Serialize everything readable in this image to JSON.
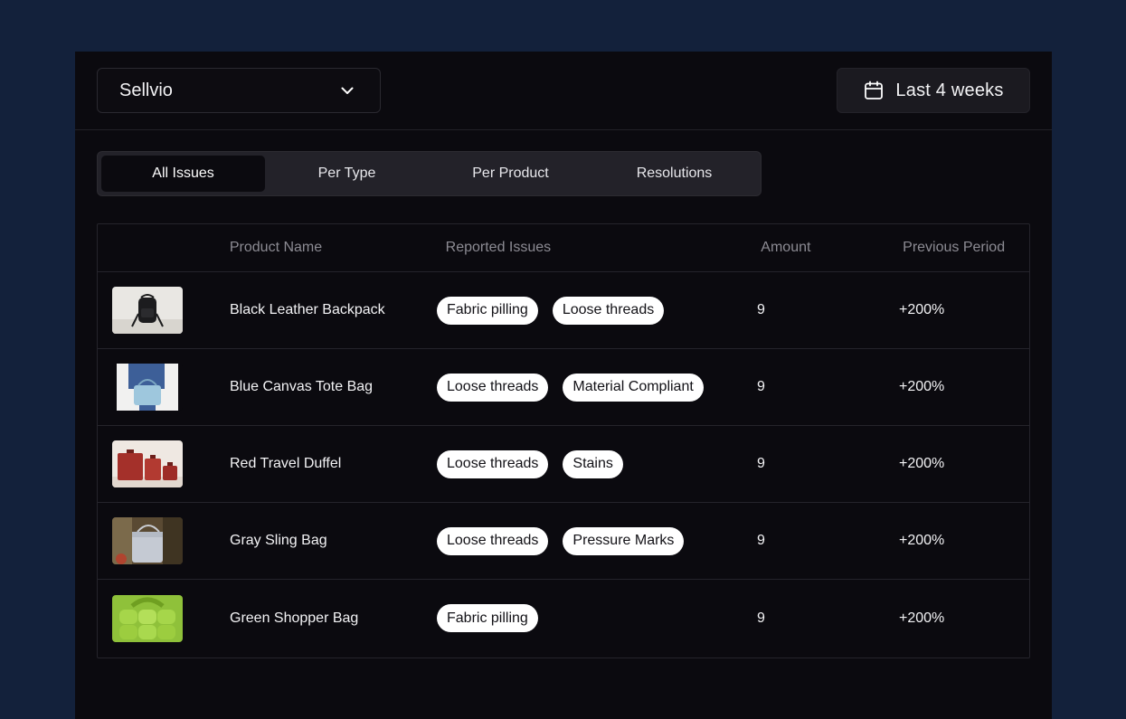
{
  "header": {
    "store_select": {
      "value": "Sellvio",
      "icon": "chevron-down-icon"
    },
    "date_range": {
      "label": "Last 4 weeks",
      "icon": "calendar-icon"
    }
  },
  "tabs": [
    {
      "label": "All Issues",
      "active": true
    },
    {
      "label": "Per Type",
      "active": false
    },
    {
      "label": "Per Product",
      "active": false
    },
    {
      "label": "Resolutions",
      "active": false
    }
  ],
  "table": {
    "columns": [
      "",
      "Product Name",
      "Reported Issues",
      "Amount",
      "Previous Period"
    ],
    "rows": [
      {
        "image": "black-backpack-image",
        "name": "Black Leather Backpack",
        "issues": [
          "Fabric pilling",
          "Loose threads"
        ],
        "amount": "9",
        "previous": "+200%"
      },
      {
        "image": "blue-tote-image",
        "name": "Blue Canvas Tote Bag",
        "issues": [
          "Loose threads",
          "Material Compliant"
        ],
        "amount": "9",
        "previous": "+200%"
      },
      {
        "image": "red-duffel-image",
        "name": "Red Travel Duffel",
        "issues": [
          "Loose threads",
          "Stains"
        ],
        "amount": "9",
        "previous": "+200%"
      },
      {
        "image": "gray-sling-image",
        "name": "Gray Sling Bag",
        "issues": [
          "Loose threads",
          "Pressure Marks"
        ],
        "amount": "9",
        "previous": "+200%"
      },
      {
        "image": "green-shopper-image",
        "name": "Green Shopper Bag",
        "issues": [
          "Fabric pilling"
        ],
        "amount": "9",
        "previous": "+200%"
      }
    ]
  },
  "colors": {
    "background": "#13213b",
    "panel": "#0b0a0f",
    "tab_bar": "#232229",
    "chip": "#ffffff",
    "muted_text": "#8c8b93"
  }
}
